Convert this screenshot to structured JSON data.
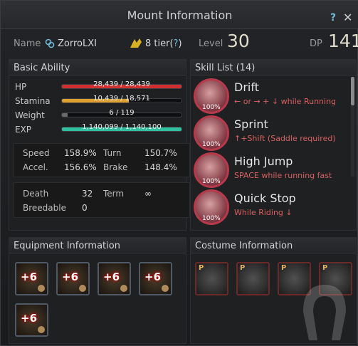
{
  "window": {
    "title": "Mount Information",
    "help": "?",
    "close": "✕"
  },
  "info": {
    "name_label": "Name",
    "name_value": "ZorroLXI",
    "tier_value": "8 tier(",
    "tier_help": "?",
    "tier_close": ")",
    "level_label": "Level",
    "level_value": "30",
    "dp_label": "DP",
    "dp_value": "141"
  },
  "basic": {
    "title": "Basic Ability",
    "bars": [
      {
        "label": "HP",
        "text": "28,439 / 28,439",
        "fill": 1.0,
        "color": "#d03030"
      },
      {
        "label": "Stamina",
        "text": "10,439 / 18,571",
        "fill": 0.562,
        "color": "#e0a030"
      },
      {
        "label": "Weight",
        "text": "6 / 119",
        "fill": 0.05,
        "color": "#6a6a6a"
      },
      {
        "label": "EXP",
        "text": "1,140,099 / 1,140,100",
        "fill": 0.999,
        "color": "#30c0a0"
      }
    ],
    "speed_label": "Speed",
    "speed_value": "158.9%",
    "turn_label": "Turn",
    "turn_value": "150.7%",
    "accel_label": "Accel.",
    "accel_value": "156.6%",
    "brake_label": "Brake",
    "brake_value": "148.4%",
    "death_label": "Death",
    "death_value": "32",
    "term_label": "Term",
    "term_value": "∞",
    "breed_label": "Breedable",
    "breed_value": "0"
  },
  "skills": {
    "title": "Skill List (14)",
    "items": [
      {
        "name": "Drift",
        "desc": "← or → + ↓ while Running",
        "pct": "100%"
      },
      {
        "name": "Sprint",
        "desc": "↑+Shift (Saddle required)",
        "pct": "100%"
      },
      {
        "name": "High Jump",
        "desc": "SPACE while running fast",
        "pct": "100%"
      },
      {
        "name": "Quick Stop",
        "desc": "While Riding ↓",
        "pct": "100%"
      }
    ]
  },
  "equipment": {
    "title": "Equipment Information",
    "slots": [
      {
        "enh": "+6",
        "icon": "horse-feet-armor-icon"
      },
      {
        "enh": "+6",
        "icon": "horse-champron-icon"
      },
      {
        "enh": "+6",
        "icon": "horse-barding-icon"
      },
      {
        "enh": "+6",
        "icon": "stirrups-icon"
      },
      {
        "enh": "+6",
        "icon": "horseshoe-icon"
      }
    ]
  },
  "costume": {
    "title": "Costume Information",
    "slots": [
      {
        "badge": "P",
        "icon": "costume-armor-icon"
      },
      {
        "badge": "P",
        "icon": "costume-champron-icon"
      },
      {
        "badge": "P",
        "icon": "costume-barding-icon"
      },
      {
        "badge": "P",
        "icon": "costume-saddle-icon"
      }
    ]
  },
  "colors": {
    "accent": "#6fb9d8",
    "skill_desc": "#d86060",
    "enh_glow": "#c00000"
  }
}
